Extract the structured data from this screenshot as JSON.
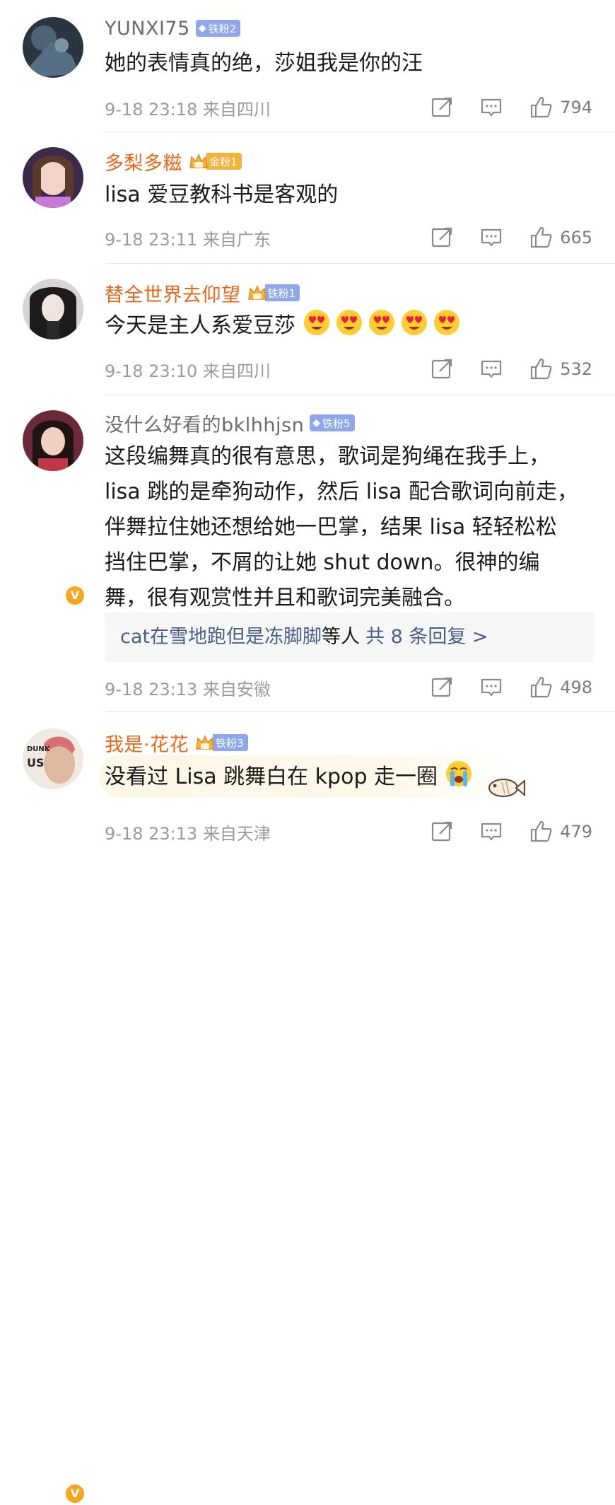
{
  "comments": [
    {
      "username": "YUNXI75",
      "badge": "铁粉2",
      "text": "她的表情真的绝，莎姐我是你的汪",
      "time": "9-18 23:18",
      "location": "来自四川",
      "likes": "794"
    },
    {
      "username": "多梨多糍",
      "badge": "金粉1",
      "text": "lisa 爱豆教科书是客观的",
      "time": "9-18 23:11",
      "location": "来自广东",
      "likes": "665"
    },
    {
      "username": "替全世界去仰望",
      "badge": "铁粉1",
      "text": "今天是主人系爱豆莎",
      "time": "9-18 23:10",
      "location": "来自四川",
      "likes": "532"
    },
    {
      "username": "没什么好看的bklhhjsn",
      "badge": "铁粉5",
      "text_lines": [
        "这段编舞真的很有意思，歌词是狗绳在我手上，",
        "lisa 跳的是牵狗动作，然后 lisa 配合歌词向前走，",
        "伴舞拉住她还想给她一巴掌，结果 lisa 轻轻松松",
        "挡住巴掌，不屑的让她 shut down。很神的编",
        "舞，很有观赏性并且和歌词完美融合。"
      ],
      "reply_names": "cat在雪地跑但是冻脚脚",
      "reply_suffix": "等人",
      "reply_total": "共 8 条回复 >",
      "time": "9-18 23:13",
      "location": "来自安徽",
      "likes": "498"
    },
    {
      "username": "我是·花花",
      "badge": "铁粉3",
      "text": "没看过 Lisa 跳舞白在 kpop 走一圈",
      "time": "9-18 23:13",
      "location": "来自天津",
      "likes": "479"
    }
  ],
  "verified_mark": "V",
  "avatar_caption_line1": "DUNK",
  "avatar_caption_line2": "US",
  "icons": [
    "share-icon",
    "comment-icon",
    "like-icon",
    "heart-eyes-emoji",
    "crying-emoji",
    "fish-sticker"
  ],
  "colors": {
    "username_gray": "#6b6b6b",
    "username_orange": "#e8661a",
    "meta_gray": "#9a9a9a",
    "reply_link": "#4a5f86",
    "verified": "#f5a623",
    "iron_badge": "#8fa6ea",
    "gold_badge": "#f2b23c"
  }
}
